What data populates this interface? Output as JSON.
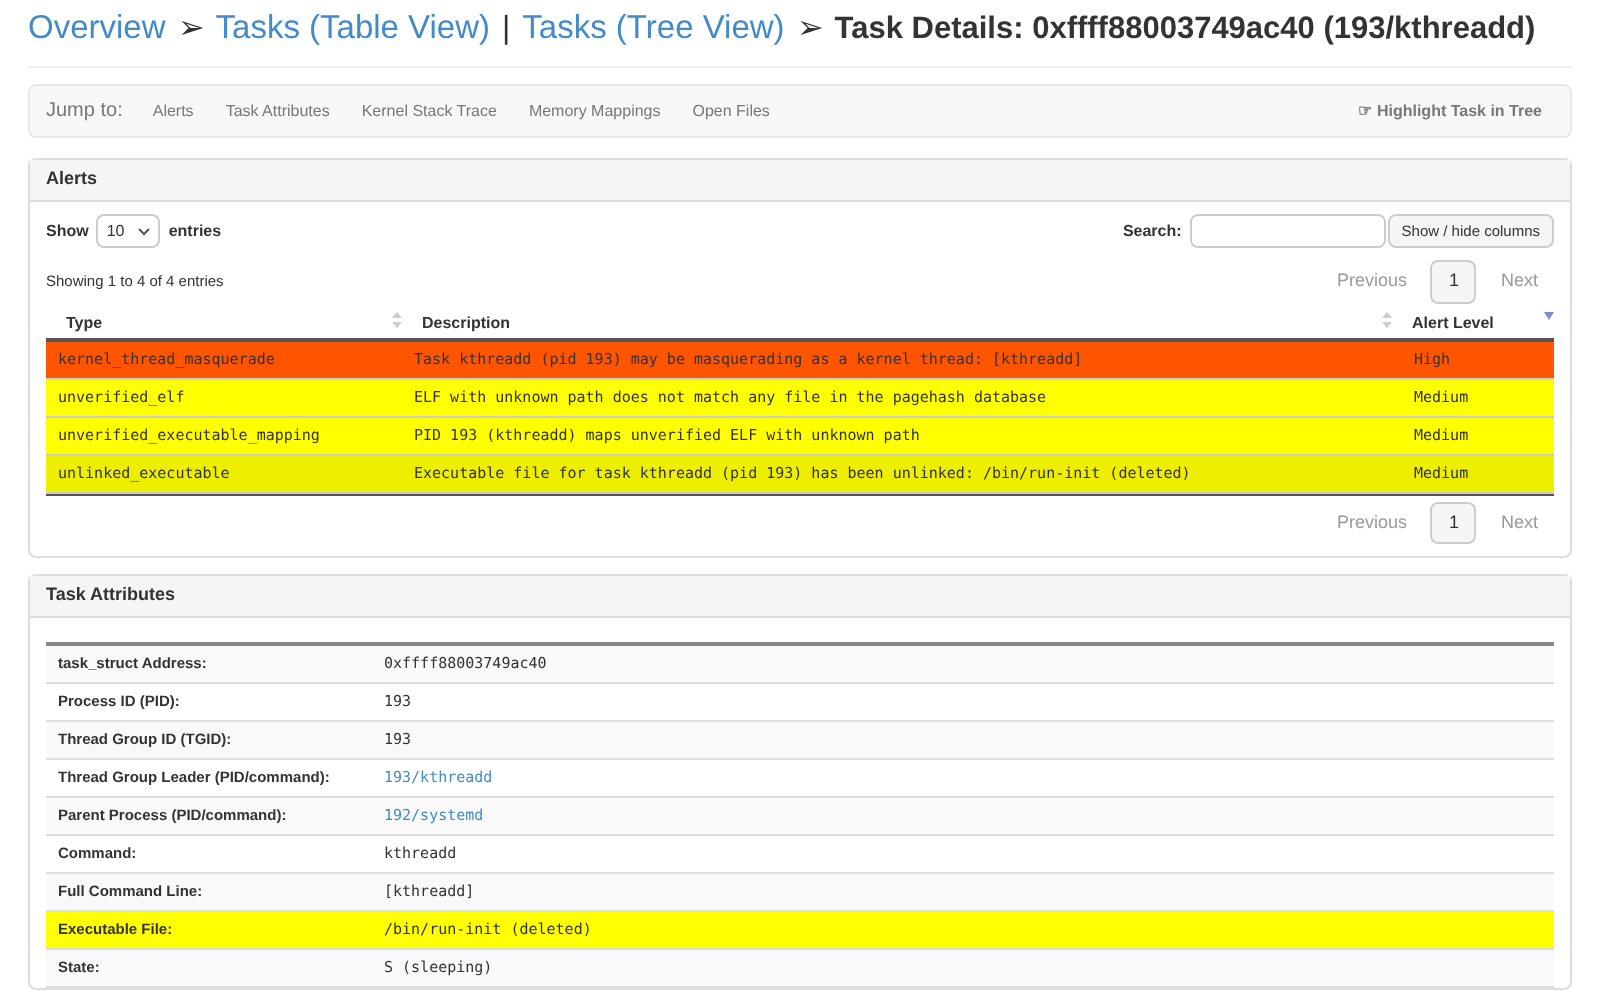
{
  "breadcrumb": [
    {
      "label": "Overview",
      "kind": "link"
    },
    {
      "label": "➢",
      "kind": "sep"
    },
    {
      "label": "Tasks (Table View)",
      "kind": "link"
    },
    {
      "label": "|",
      "kind": "sep"
    },
    {
      "label": "Tasks (Tree View)",
      "kind": "link"
    },
    {
      "label": "➢",
      "kind": "sep"
    },
    {
      "label": "Task Details: 0xffff88003749ac40 (193/kthreadd)",
      "kind": "current"
    }
  ],
  "jump_bar": {
    "label": "Jump to:",
    "links": [
      "Alerts",
      "Task Attributes",
      "Kernel Stack Trace",
      "Memory Mappings",
      "Open Files"
    ],
    "action": "☞ Highlight Task in Tree"
  },
  "alerts": {
    "title": "Alerts",
    "show_label": "Show",
    "page_size": "10",
    "entries_label": "entries",
    "search_label": "Search:",
    "columns_button": "Show / hide columns",
    "info": "Showing 1 to 4 of 4 entries",
    "pagination_top": {
      "previous": "Previous",
      "page": "1",
      "next": "Next"
    },
    "pagination_bottom": {
      "previous": "Previous",
      "page": "1",
      "next": "Next"
    },
    "columns": [
      "Type",
      "Description",
      "Alert Level"
    ],
    "rows": [
      {
        "type": "kernel_thread_masquerade",
        "description": "Task kthreadd (pid 193) may be masquerading as a kernel thread: [kthreadd]",
        "level": "High",
        "color": "#ff5500"
      },
      {
        "type": "unverified_elf",
        "description": "ELF with unknown path does not match any file in the pagehash database",
        "level": "Medium",
        "color": "#ffff00"
      },
      {
        "type": "unverified_executable_mapping",
        "description": "PID 193 (kthreadd) maps unverified ELF with unknown path",
        "level": "Medium",
        "color": "#ffff00"
      },
      {
        "type": "unlinked_executable",
        "description": "Executable file for task kthreadd (pid 193) has been unlinked: /bin/run-init (deleted)",
        "level": "Medium",
        "color": "#eeee00"
      }
    ]
  },
  "task_attributes": {
    "title": "Task Attributes",
    "rows": [
      {
        "label": "task_struct Address:",
        "value": "0xffff88003749ac40",
        "kind": "text",
        "highlighted": false
      },
      {
        "label": "Process ID (PID):",
        "value": "193",
        "kind": "text",
        "highlighted": false
      },
      {
        "label": "Thread Group ID (TGID):",
        "value": "193",
        "kind": "text",
        "highlighted": false
      },
      {
        "label": "Thread Group Leader (PID/command):",
        "value": "193/kthreadd",
        "kind": "link",
        "highlighted": false
      },
      {
        "label": "Parent Process (PID/command):",
        "value": "192/systemd",
        "kind": "link",
        "highlighted": false
      },
      {
        "label": "Command:",
        "value": "kthreadd",
        "kind": "text",
        "highlighted": false
      },
      {
        "label": "Full Command Line:",
        "value": "[kthreadd]",
        "kind": "text",
        "highlighted": false
      },
      {
        "label": "Executable File:",
        "value": "/bin/run-init (deleted)",
        "kind": "text",
        "highlighted": true
      },
      {
        "label": "State:",
        "value": "S (sleeping)",
        "kind": "text",
        "highlighted": false
      }
    ]
  }
}
